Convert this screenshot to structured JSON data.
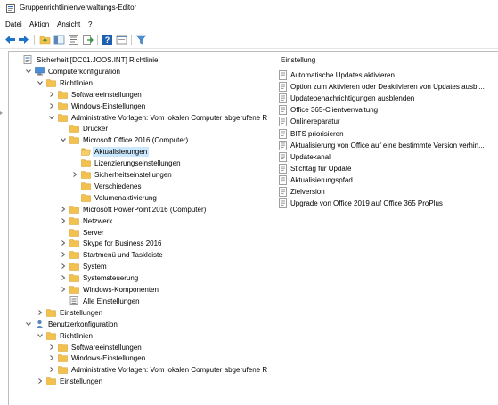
{
  "window": {
    "title": "Gruppenrichtlinienverwaltungs-Editor"
  },
  "menu": [
    "Datei",
    "Aktion",
    "Ansicht",
    "?"
  ],
  "toolbar": [
    "back-icon",
    "forward-icon",
    "up-folder-icon",
    "show-hide-tree-icon",
    "properties-icon",
    "export-list-icon",
    "help-icon",
    "console-icon",
    "filter-icon"
  ],
  "tree": [
    {
      "label": "Sicherheit [DC01.JOOS.INT] Richtlinie",
      "icon": "policy-icon",
      "chevron": "none"
    },
    {
      "label": "Computerkonfiguration",
      "icon": "computer-icon",
      "chevron": "down"
    },
    {
      "label": "Richtlinien",
      "icon": "folder-icon",
      "chevron": "down"
    },
    {
      "label": "Softwareeinstellungen",
      "icon": "folder-icon",
      "chevron": "right"
    },
    {
      "label": "Windows-Einstellungen",
      "icon": "folder-icon",
      "chevron": "right"
    },
    {
      "label": "Administrative Vorlagen: Vom lokalen Computer abgerufene R",
      "icon": "folder-icon",
      "chevron": "down"
    },
    {
      "label": "Drucker",
      "icon": "folder-icon",
      "chevron": "none"
    },
    {
      "label": "Microsoft Office 2016 (Computer)",
      "icon": "folder-icon",
      "chevron": "down"
    },
    {
      "label": "Aktualisierungen",
      "icon": "folder-open-icon",
      "chevron": "none",
      "selected": true
    },
    {
      "label": "Lizenzierungseinstellungen",
      "icon": "folder-icon",
      "chevron": "none"
    },
    {
      "label": "Sicherheitseinstellungen",
      "icon": "folder-icon",
      "chevron": "right"
    },
    {
      "label": "Verschiedenes",
      "icon": "folder-icon",
      "chevron": "none"
    },
    {
      "label": "Volumenaktivierung",
      "icon": "folder-icon",
      "chevron": "none"
    },
    {
      "label": "Microsoft PowerPoint 2016 (Computer)",
      "icon": "folder-icon",
      "chevron": "right"
    },
    {
      "label": "Netzwerk",
      "icon": "folder-icon",
      "chevron": "right"
    },
    {
      "label": "Server",
      "icon": "folder-icon",
      "chevron": "none"
    },
    {
      "label": "Skype for Business 2016",
      "icon": "folder-icon",
      "chevron": "right"
    },
    {
      "label": "Startmenü und Taskleiste",
      "icon": "folder-icon",
      "chevron": "right"
    },
    {
      "label": "System",
      "icon": "folder-icon",
      "chevron": "right"
    },
    {
      "label": "Systemsteuerung",
      "icon": "folder-icon",
      "chevron": "right"
    },
    {
      "label": "Windows-Komponenten",
      "icon": "folder-icon",
      "chevron": "right"
    },
    {
      "label": "Alle Einstellungen",
      "icon": "all-settings-icon",
      "chevron": "none"
    },
    {
      "label": "Einstellungen",
      "icon": "folder-icon",
      "chevron": "right"
    },
    {
      "label": "Benutzerkonfiguration",
      "icon": "user-icon",
      "chevron": "down"
    },
    {
      "label": "Richtlinien",
      "icon": "folder-icon",
      "chevron": "down"
    },
    {
      "label": "Softwareeinstellungen",
      "icon": "folder-icon",
      "chevron": "right"
    },
    {
      "label": "Windows-Einstellungen",
      "icon": "folder-icon",
      "chevron": "right"
    },
    {
      "label": "Administrative Vorlagen: Vom lokalen Computer abgerufene R",
      "icon": "folder-icon",
      "chevron": "right"
    },
    {
      "label": "Einstellungen",
      "icon": "folder-icon",
      "chevron": "right"
    }
  ],
  "details": {
    "column_header": "Einstellung",
    "items": [
      "Automatische Updates aktivieren",
      "Option zum Aktivieren oder Deaktivieren von Updates ausbl...",
      "Updatebenachrichtigungen ausblenden",
      "Office 365-Clientverwaltung",
      "Onlinereparatur",
      "BITS priorisieren",
      "Aktualisierung von Office auf eine bestimmte Version verhin...",
      "Updatekanal",
      "Stichtag für Update",
      "Aktualisierungspfad",
      "Zielversion",
      "Upgrade von Office 2019 auf Office 365 ProPlus"
    ]
  },
  "colors": {
    "folder": "#f2c14e",
    "folder_edge": "#d9a233",
    "selection": "#cce8ff",
    "accent": "#1e73c8"
  }
}
